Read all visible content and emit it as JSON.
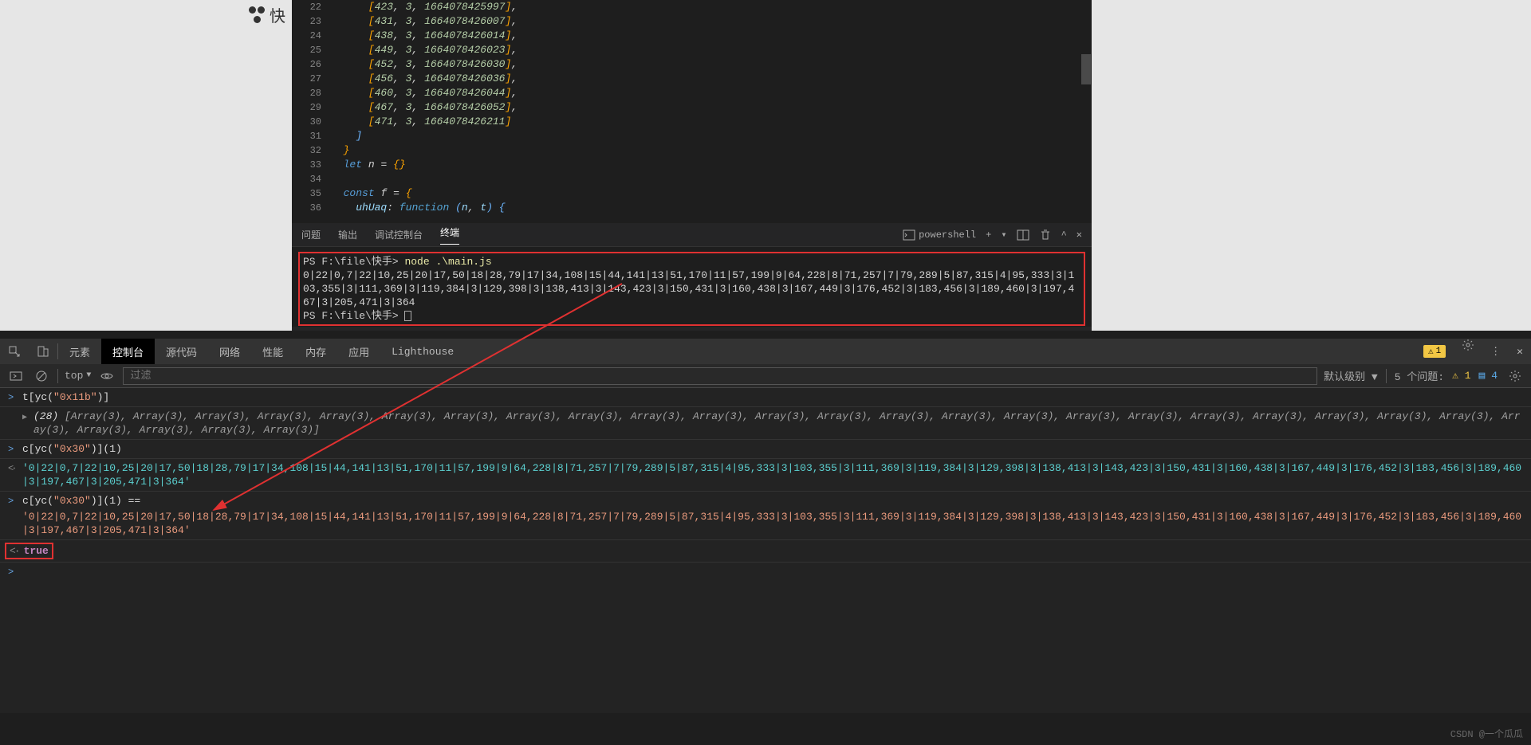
{
  "logo_text": "快",
  "code": {
    "line_start": 22,
    "lines": [
      {
        "n": 22,
        "t": "array"
      },
      {
        "n": 23,
        "t": "array"
      },
      {
        "n": 24,
        "t": "array"
      },
      {
        "n": 25,
        "t": "array"
      },
      {
        "n": 26,
        "t": "array"
      },
      {
        "n": 27,
        "t": "array"
      },
      {
        "n": 28,
        "t": "array"
      },
      {
        "n": 29,
        "t": "array"
      },
      {
        "n": 30,
        "t": "array_last"
      },
      {
        "n": 31,
        "t": "close_bracket"
      },
      {
        "n": 32,
        "t": "close_brace"
      },
      {
        "n": 33,
        "t": "let_n"
      },
      {
        "n": 34,
        "t": "blank"
      },
      {
        "n": 35,
        "t": "const_f"
      },
      {
        "n": 36,
        "t": "uhUaq"
      }
    ],
    "rows": [
      [
        423,
        3,
        "1664078425997"
      ],
      [
        431,
        3,
        "1664078426007"
      ],
      [
        438,
        3,
        "1664078426014"
      ],
      [
        449,
        3,
        "1664078426023"
      ],
      [
        452,
        3,
        "1664078426030"
      ],
      [
        456,
        3,
        "1664078426036"
      ],
      [
        460,
        3,
        "1664078426044"
      ],
      [
        467,
        3,
        "1664078426052"
      ],
      [
        471,
        3,
        "1664078426211"
      ]
    ],
    "let_n": "let n = {}",
    "const_f": "const f = {",
    "uhUaq_key": "uhUaq",
    "uhUaq_fn": "function",
    "uhUaq_params": "(n, t)"
  },
  "panel": {
    "tabs": [
      "问题",
      "输出",
      "调试控制台",
      "终端"
    ],
    "active": 3,
    "shell": "powershell"
  },
  "terminal": {
    "prompt1": "PS F:\\file\\快手>",
    "command": "node .\\main.js",
    "output": "0|22|0,7|22|10,25|20|17,50|18|28,79|17|34,108|15|44,141|13|51,170|11|57,199|9|64,228|8|71,257|7|79,289|5|87,315|4|95,333|3|103,355|3|111,369|3|119,384|3|129,398|3|138,413|3|143,423|3|150,431|3|160,438|3|167,449|3|176,452|3|183,456|3|189,460|3|197,467|3|205,471|3|364",
    "prompt2": "PS F:\\file\\快手>"
  },
  "devtools": {
    "left_icons": [
      "inspect",
      "device"
    ],
    "tabs": [
      "元素",
      "控制台",
      "源代码",
      "网络",
      "性能",
      "内存",
      "应用",
      "Lighthouse"
    ],
    "active": 1,
    "warn_count": "1",
    "toolbar": {
      "scope": "top",
      "filter_placeholder": "过滤",
      "level": "默认级别",
      "issues_label": "5 个问题:",
      "warn_n": "1",
      "info_n": "4"
    }
  },
  "console": {
    "r1": {
      "expr_prefix": "t[yc(",
      "expr_str": "\"0x11b\"",
      "expr_suffix": ")]"
    },
    "r2": {
      "count": "(28)",
      "body": " [Array(3), Array(3), Array(3), Array(3), Array(3), Array(3), Array(3), Array(3), Array(3), Array(3), Array(3), Array(3), Array(3), Array(3), Array(3), Array(3), Array(3), Array(3), Array(3), Array(3), Array(3), Array(3), Array(3), Array(3), Array(3), Array(3), Array(3), Array(3)]"
    },
    "r3": {
      "expr_prefix": "c[yc(",
      "expr_str": "\"0x30\"",
      "expr_suffix": ")](1)"
    },
    "r4": "'0|22|0,7|22|10,25|20|17,50|18|28,79|17|34,108|15|44,141|13|51,170|11|57,199|9|64,228|8|71,257|7|79,289|5|87,315|4|95,333|3|103,355|3|111,369|3|119,384|3|129,398|3|138,413|3|143,423|3|150,431|3|160,438|3|167,449|3|176,452|3|183,456|3|189,460|3|197,467|3|205,471|3|364'",
    "r5": {
      "expr_prefix": "c[yc(",
      "expr_str": "\"0x30\"",
      "expr_suffix": ")](1) =="
    },
    "r6": "'0|22|0,7|22|10,25|20|17,50|18|28,79|17|34,108|15|44,141|13|51,170|11|57,199|9|64,228|8|71,257|7|79,289|5|87,315|4|95,333|3|103,355|3|111,369|3|119,384|3|129,398|3|138,413|3|143,423|3|150,431|3|160,438|3|167,449|3|176,452|3|183,456|3|189,460|3|197,467|3|205,471|3|364'",
    "result": "true"
  },
  "watermark": "CSDN @一个瓜瓜"
}
